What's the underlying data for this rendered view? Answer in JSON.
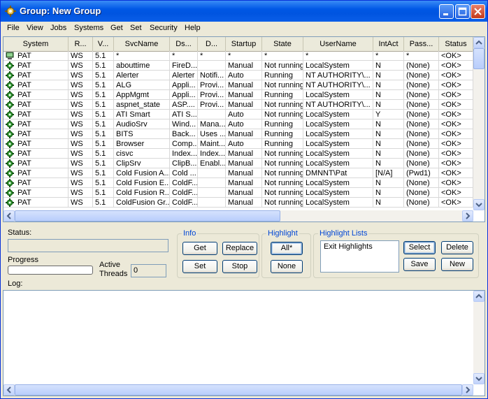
{
  "window": {
    "title": "Group: New Group"
  },
  "menu": [
    "File",
    "View",
    "Jobs",
    "Systems",
    "Get",
    "Set",
    "Security",
    "Help"
  ],
  "grid": {
    "columns": [
      "System",
      "R...",
      "V...",
      "SvcName",
      "Ds...",
      "D...",
      "Startup",
      "State",
      "UserName",
      "IntAct",
      "Pass...",
      "Status"
    ],
    "filter_row": [
      "PAT",
      "WS",
      "5.1",
      "*",
      "*",
      "*",
      "*",
      "*",
      "*",
      "*",
      "*",
      "<OK>"
    ],
    "rows": [
      [
        "PAT",
        "WS",
        "5.1",
        "abouttime",
        "FireD...",
        "",
        "Manual",
        "Not running",
        "LocalSystem",
        "N",
        "(None)",
        "<OK>"
      ],
      [
        "PAT",
        "WS",
        "5.1",
        "Alerter",
        "Alerter",
        "Notifi...",
        "Auto",
        "Running",
        "NT AUTHORITY\\...",
        "N",
        "(None)",
        "<OK>"
      ],
      [
        "PAT",
        "WS",
        "5.1",
        "ALG",
        "Appli...",
        "Provi...",
        "Manual",
        "Not running",
        "NT AUTHORITY\\...",
        "N",
        "(None)",
        "<OK>"
      ],
      [
        "PAT",
        "WS",
        "5.1",
        "AppMgmt",
        "Appli...",
        "Provi...",
        "Manual",
        "Running",
        "LocalSystem",
        "N",
        "(None)",
        "<OK>"
      ],
      [
        "PAT",
        "WS",
        "5.1",
        "aspnet_state",
        "ASP....",
        "Provi...",
        "Manual",
        "Not running",
        "NT AUTHORITY\\...",
        "N",
        "(None)",
        "<OK>"
      ],
      [
        "PAT",
        "WS",
        "5.1",
        "ATI Smart",
        "ATI S...",
        "",
        "Auto",
        "Not running",
        "LocalSystem",
        "Y",
        "(None)",
        "<OK>"
      ],
      [
        "PAT",
        "WS",
        "5.1",
        "AudioSrv",
        "Wind...",
        "Mana...",
        "Auto",
        "Running",
        "LocalSystem",
        "N",
        "(None)",
        "<OK>"
      ],
      [
        "PAT",
        "WS",
        "5.1",
        "BITS",
        "Back...",
        "Uses ...",
        "Manual",
        "Running",
        "LocalSystem",
        "N",
        "(None)",
        "<OK>"
      ],
      [
        "PAT",
        "WS",
        "5.1",
        "Browser",
        "Comp...",
        "Maint...",
        "Auto",
        "Running",
        "LocalSystem",
        "N",
        "(None)",
        "<OK>"
      ],
      [
        "PAT",
        "WS",
        "5.1",
        "cisvc",
        "Index...",
        "Index...",
        "Manual",
        "Not running",
        "LocalSystem",
        "N",
        "(None)",
        "<OK>"
      ],
      [
        "PAT",
        "WS",
        "5.1",
        "ClipSrv",
        "ClipB...",
        "Enabl...",
        "Manual",
        "Not running",
        "LocalSystem",
        "N",
        "(None)",
        "<OK>"
      ],
      [
        "PAT",
        "WS",
        "5.1",
        "Cold Fusion A...",
        "Cold ...",
        "",
        "Manual",
        "Not running",
        "DMNNT\\Pat",
        "[N/A]",
        "(Pwd1)",
        "<OK>"
      ],
      [
        "PAT",
        "WS",
        "5.1",
        "Cold Fusion E...",
        "ColdF...",
        "",
        "Manual",
        "Not running",
        "LocalSystem",
        "N",
        "(None)",
        "<OK>"
      ],
      [
        "PAT",
        "WS",
        "5.1",
        "Cold Fusion R...",
        "ColdF...",
        "",
        "Manual",
        "Not running",
        "LocalSystem",
        "N",
        "(None)",
        "<OK>"
      ],
      [
        "PAT",
        "WS",
        "5.1",
        "ColdFusion Gr...",
        "ColdF...",
        "",
        "Manual",
        "Not running",
        "LocalSystem",
        "N",
        "(None)",
        "<OK>"
      ]
    ]
  },
  "panel": {
    "status_label": "Status:",
    "progress_label": "Progress",
    "active_threads_label": "Active\nThreads",
    "active_threads_value": "0",
    "log_label": "Log:",
    "info_label": "Info",
    "get_label": "Get",
    "replace_label": "Replace",
    "set_label": "Set",
    "stop_label": "Stop",
    "highlight_label": "Highlight",
    "all_label": "All*",
    "none_label": "None",
    "highlight_lists_label": "Highlight Lists",
    "highlight_list_items": [
      "Exit Highlights"
    ],
    "select_label": "Select",
    "delete_label": "Delete",
    "save_label": "Save",
    "new_label": "New"
  },
  "colors": {
    "title_bar": "#0058e6",
    "legend_text": "#0046d5",
    "service_icon": "#2d9a2d"
  }
}
